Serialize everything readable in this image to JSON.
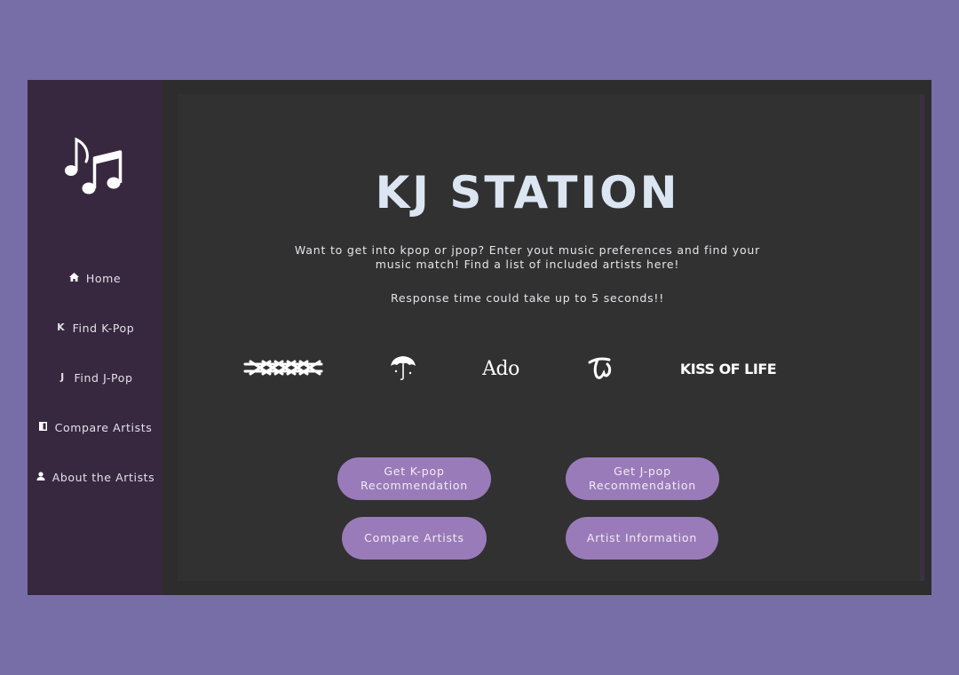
{
  "sidebar": {
    "logo_icon": "music-notes-icon",
    "items": [
      {
        "icon": "home-icon",
        "label": "Home"
      },
      {
        "icon": "k-letter-icon",
        "glyph": "K",
        "label": "Find K-Pop"
      },
      {
        "icon": "j-letter-icon",
        "glyph": "J",
        "label": "Find J-Pop"
      },
      {
        "icon": "compare-icon",
        "label": "Compare Artists"
      },
      {
        "icon": "person-icon",
        "label": "About the Artists"
      }
    ]
  },
  "main": {
    "title": "KJ STATION",
    "intro": "Want to get into kpop or jpop? Enter yout music preferences and find your music match! Find a list of included artists here!",
    "note": "Response time could take up to 5 seconds!!",
    "artist_logos": [
      {
        "name": "crossed-out-logo"
      },
      {
        "name": "umbrella-logo"
      },
      {
        "name": "ado-logo",
        "text": "Ado"
      },
      {
        "name": "twice-logo"
      },
      {
        "name": "kiss-of-life-logo",
        "text": "KISS OF LIFE"
      }
    ],
    "buttons": {
      "kpop": "Get K-pop Recommendation",
      "jpop": "Get J-pop Recommendation",
      "compare": "Compare Artists",
      "info": "Artist Information"
    }
  },
  "colors": {
    "page_bg": "#776ea7",
    "sidebar_bg": "#37283f",
    "main_bg": "#313131",
    "button": "#9a7bb9",
    "title": "#dce6f2"
  }
}
